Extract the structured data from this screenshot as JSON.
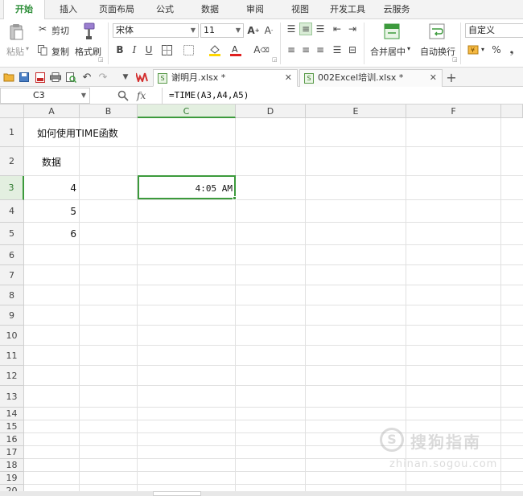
{
  "menu": {
    "tabs": [
      {
        "label": "开始",
        "active": true
      },
      {
        "label": "插入",
        "active": false
      },
      {
        "label": "页面布局",
        "active": false
      },
      {
        "label": "公式",
        "active": false
      },
      {
        "label": "数据",
        "active": false
      },
      {
        "label": "审阅",
        "active": false
      },
      {
        "label": "视图",
        "active": false
      },
      {
        "label": "开发工具",
        "active": false
      },
      {
        "label": "云服务",
        "active": false
      }
    ]
  },
  "ribbon": {
    "paste_label": "粘贴",
    "cut_label": "剪切",
    "copy_label": "复制",
    "format_painter_label": "格式刷",
    "font_name": "宋体",
    "font_size": "11",
    "merge_center_label": "合并居中",
    "wrap_text_label": "自动换行",
    "number_format": "自定义"
  },
  "doc_tabs": [
    {
      "label": "谢明月.xlsx *",
      "active": true
    },
    {
      "label": "002Excel培训.xlsx *",
      "active": false
    }
  ],
  "formula_bar": {
    "name_box": "C3",
    "fx_label": "fx",
    "formula": "=TIME(A3,A4,A5)"
  },
  "sheet": {
    "columns": [
      "A",
      "B",
      "C",
      "D",
      "E",
      "F"
    ],
    "rows": [
      "1",
      "2",
      "3",
      "4",
      "5",
      "6",
      "7",
      "8",
      "9",
      "10",
      "11",
      "12",
      "13",
      "14",
      "15",
      "16",
      "17",
      "18",
      "19",
      "20"
    ],
    "cells": {
      "A1": "如何使用TIME函数",
      "A2": "数据",
      "A3": "4",
      "A4": "5",
      "A5": "6",
      "C3": "4:05 AM"
    },
    "selected_cell": "C3"
  },
  "watermark": {
    "brand": "搜狗指南",
    "url": "zhinan.sogou.com"
  },
  "colors": {
    "accent_green": "#3c9a3c",
    "active_tab_text": "#2f8f3a"
  }
}
